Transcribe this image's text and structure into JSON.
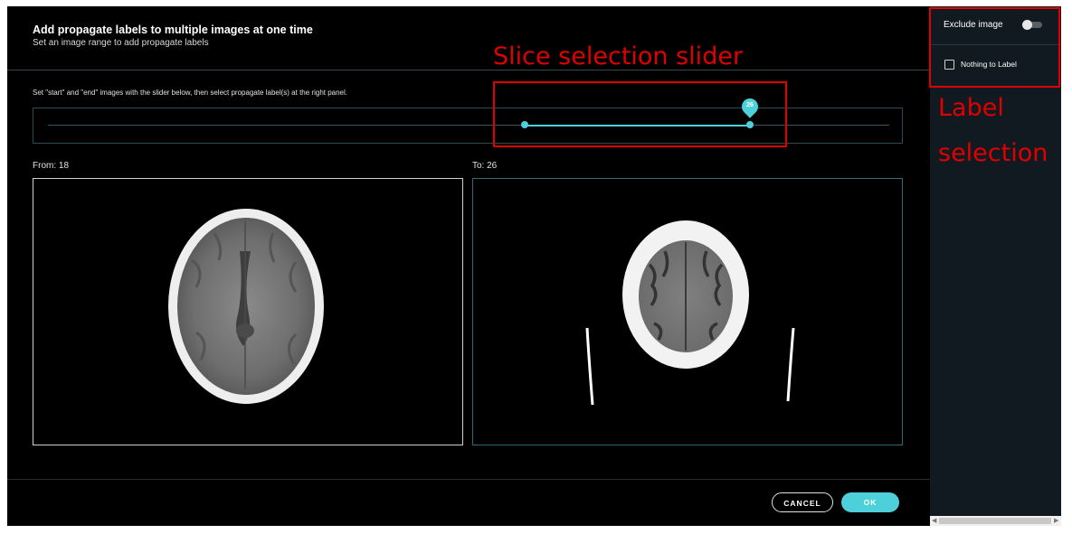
{
  "dialog": {
    "title": "Add propagate labels to multiple images at one time",
    "subtitle": "Set an image range to add propagate labels",
    "instruction": "Set \"start\" and \"end\" images with the slider below, then select propagate label(s) at the right panel.",
    "slider": {
      "start": 18,
      "end": 26,
      "value_label": "26"
    },
    "from_label": "From: 18",
    "to_label": "To: 26",
    "cancel_label": "CANCEL",
    "ok_label": "OK"
  },
  "sidebar": {
    "exclude_label": "Exclude image",
    "exclude_on": false,
    "nothing_label": "Nothing to Label",
    "nothing_checked": false
  },
  "annotations": {
    "slider_note": "Slice selection slider",
    "label_note_line1": "Label",
    "label_note_line2": "selection"
  },
  "colors": {
    "accent": "#4dd0d9",
    "annotation": "#e00000",
    "background": "#000000",
    "panel": "#111921"
  }
}
